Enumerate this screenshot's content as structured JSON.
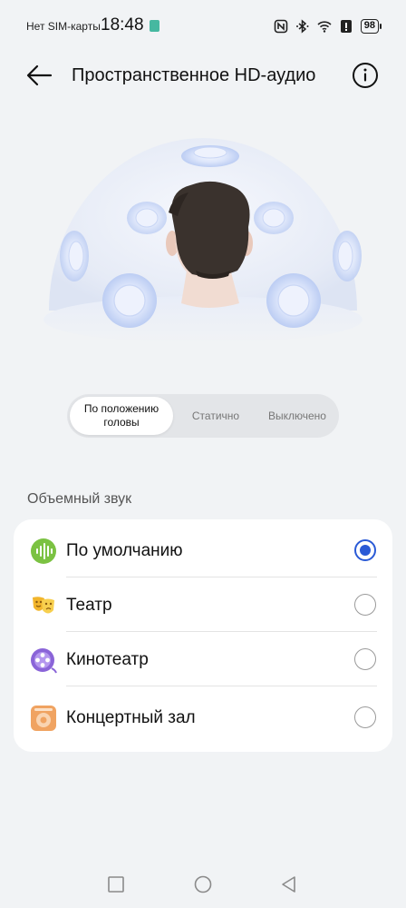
{
  "status_bar": {
    "carrier": "Нет SIM-карты",
    "time": "18:48",
    "battery": "98"
  },
  "app_bar": {
    "title": "Пространственное HD-аудио"
  },
  "mode_selector": {
    "options": [
      "По положению головы",
      "Статично",
      "Выключено"
    ],
    "selected": "По положению головы"
  },
  "surround_section": {
    "label": "Объемный звук",
    "options": [
      {
        "label": "По умолчанию",
        "icon": "soundwave-icon",
        "checked": true
      },
      {
        "label": "Театр",
        "icon": "theater-masks-icon",
        "checked": false
      },
      {
        "label": "Кинотеатр",
        "icon": "film-reel-icon",
        "checked": false
      },
      {
        "label": "Концертный зал",
        "icon": "concert-hall-icon",
        "checked": false
      }
    ]
  },
  "nav_bar": {
    "buttons": [
      "recent-apps",
      "home",
      "back"
    ]
  }
}
